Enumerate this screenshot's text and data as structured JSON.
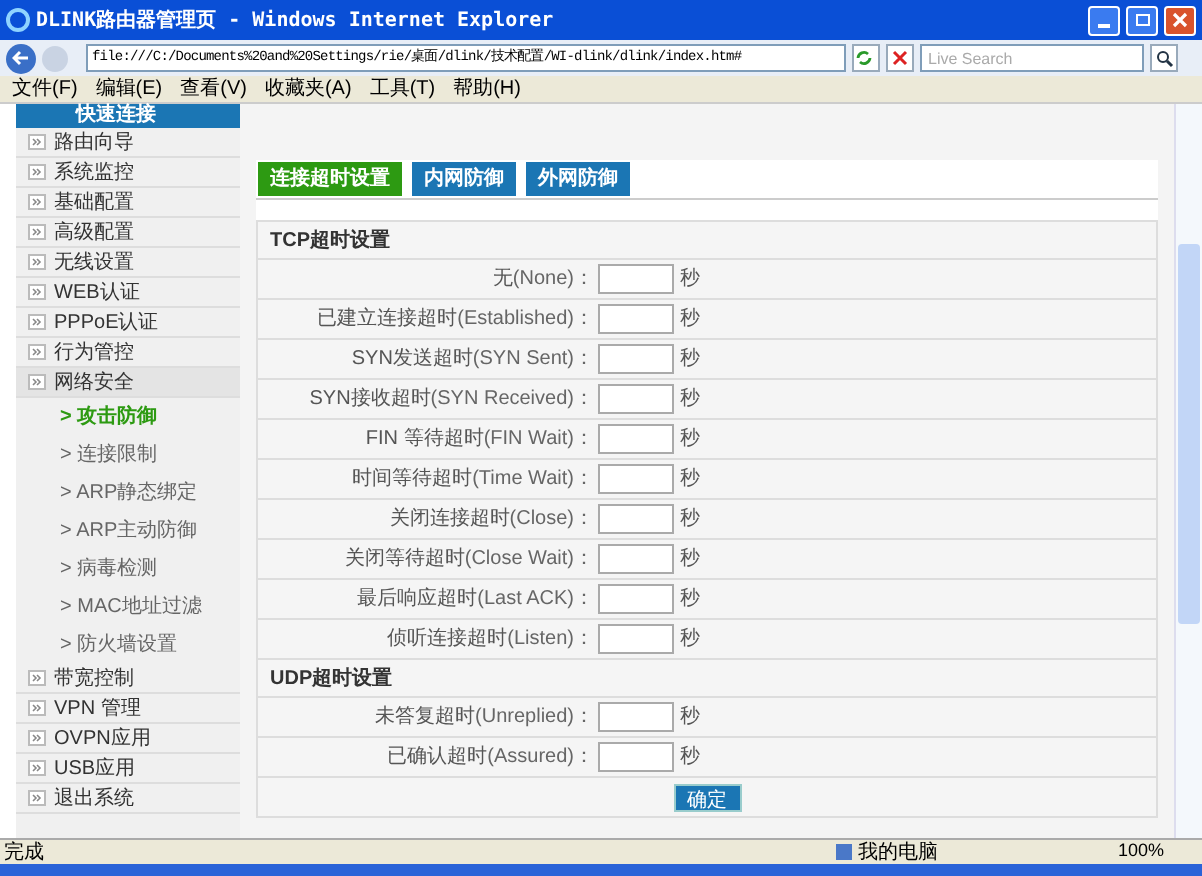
{
  "window": {
    "title": "DLINK路由器管理页 - Windows Internet Explorer"
  },
  "address_bar": {
    "url": "file:///C:/Documents%20and%20Settings/rie/桌面/dlink/技术配置/WI-dlink/dlink/index.htm#",
    "search_placeholder": "Live Search"
  },
  "menu": [
    "文件(F)",
    "编辑(E)",
    "查看(V)",
    "收藏夹(A)",
    "工具(T)",
    "帮助(H)"
  ],
  "sidebar": {
    "header": "快速连接",
    "items": [
      {
        "label": "路由向导",
        "expanded": false
      },
      {
        "label": "系统监控",
        "expanded": false
      },
      {
        "label": "基础配置",
        "expanded": false
      },
      {
        "label": "高级配置",
        "expanded": false
      },
      {
        "label": "无线设置",
        "expanded": false
      },
      {
        "label": "WEB认证",
        "expanded": false
      },
      {
        "label": "PPPoE认证",
        "expanded": false
      },
      {
        "label": "行为管控",
        "expanded": false
      },
      {
        "label": "网络安全",
        "expanded": true,
        "children": [
          {
            "label": "> 攻击防御",
            "selected": true
          },
          {
            "label": "> 连接限制",
            "selected": false
          },
          {
            "label": "> ARP静态绑定",
            "selected": false
          },
          {
            "label": "> ARP主动防御",
            "selected": false
          },
          {
            "label": "> 病毒检测",
            "selected": false
          },
          {
            "label": "> MAC地址过滤",
            "selected": false
          },
          {
            "label": "> 防火墙设置",
            "selected": false
          }
        ]
      },
      {
        "label": "带宽控制",
        "expanded": false
      },
      {
        "label": "VPN 管理",
        "expanded": false
      },
      {
        "label": "OVPN应用",
        "expanded": false
      },
      {
        "label": "USB应用",
        "expanded": false
      },
      {
        "label": "退出系统",
        "expanded": false
      }
    ]
  },
  "tabs": [
    {
      "label": "连接超时设置",
      "selected": true
    },
    {
      "label": "内网防御",
      "selected": false
    },
    {
      "label": "外网防御",
      "selected": false
    }
  ],
  "sections": [
    {
      "title": "TCP超时设置",
      "rows": [
        {
          "prefix": "无",
          "label": "(None)：",
          "unit": "秒"
        },
        {
          "prefix": "已建立连接超时",
          "label": "(Established)：",
          "unit": "秒"
        },
        {
          "prefix": "SYN发送超时",
          "label": "(SYN Sent)：",
          "unit": "秒"
        },
        {
          "prefix": "SYN接收超时",
          "label": "(SYN Received)：",
          "unit": "秒"
        },
        {
          "prefix": "FIN 等待超时",
          "label": "(FIN Wait)：",
          "unit": "秒"
        },
        {
          "prefix": "时间等待超时",
          "label": "(Time Wait)：",
          "unit": "秒"
        },
        {
          "prefix": "关闭连接超时",
          "label": "(Close)：",
          "unit": "秒"
        },
        {
          "prefix": "关闭等待超时",
          "label": "(Close Wait)：",
          "unit": "秒"
        },
        {
          "prefix": "最后响应超时",
          "label": "(Last ACK)：",
          "unit": "秒"
        },
        {
          "prefix": "侦听连接超时",
          "label": "(Listen)：",
          "unit": "秒"
        }
      ]
    },
    {
      "title": "UDP超时设置",
      "rows": [
        {
          "prefix": "未答复超时",
          "label": "(Unreplied)：",
          "unit": "秒"
        },
        {
          "prefix": "已确认超时",
          "label": "(Assured)：",
          "unit": "秒"
        }
      ]
    }
  ],
  "submit_button": "确定",
  "status_bar": {
    "status": "完成",
    "zone": "我的电脑",
    "zoom": "100%"
  }
}
